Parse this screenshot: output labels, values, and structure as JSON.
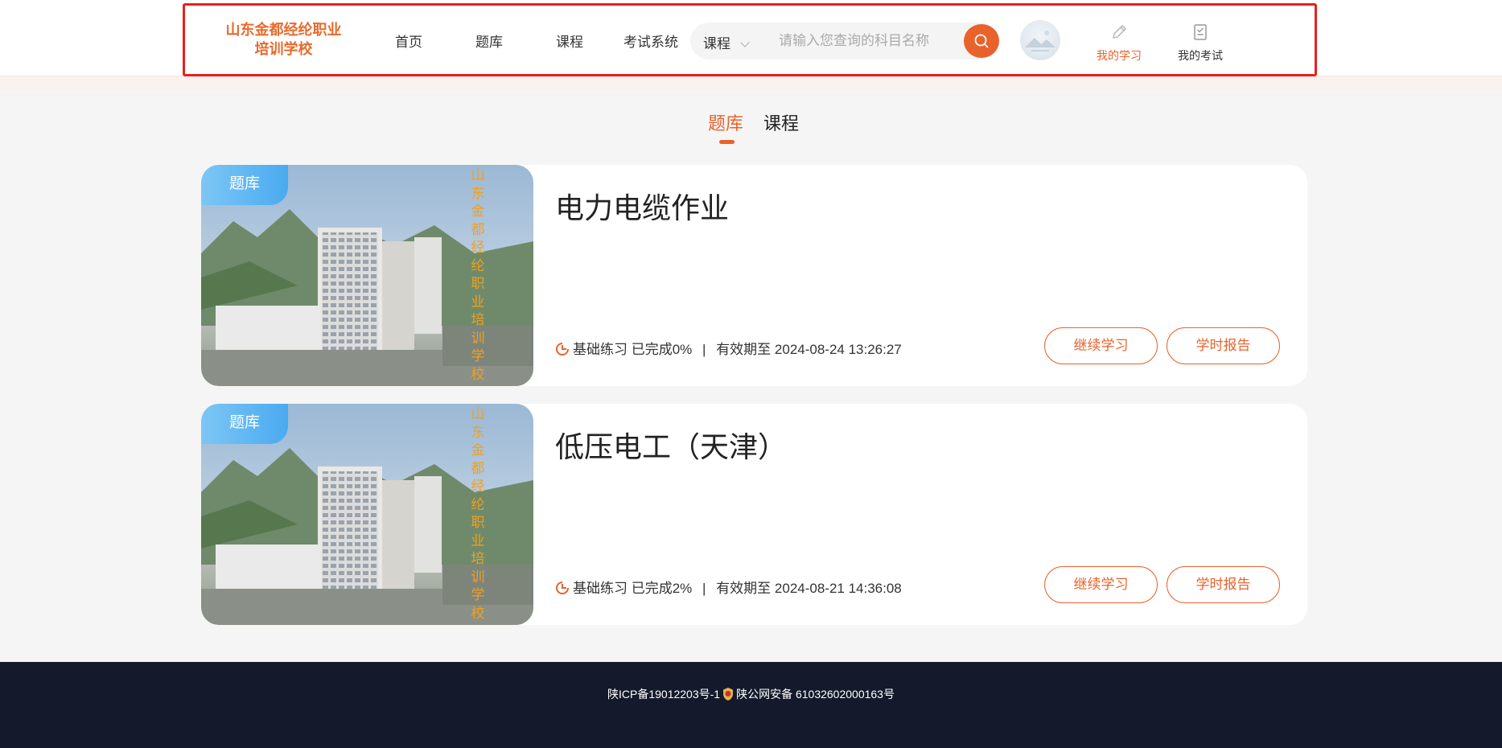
{
  "header": {
    "logo_line1": "山东金都经纶职业",
    "logo_line2": "培训学校",
    "nav": [
      {
        "label": "首页"
      },
      {
        "label": "题库"
      },
      {
        "label": "课程"
      },
      {
        "label": "考试系统"
      }
    ],
    "search": {
      "category": "课程",
      "placeholder": "请输入您查询的科目名称",
      "icon": "search-icon"
    },
    "avatar_icon": "avatar",
    "links": [
      {
        "label": "我的学习",
        "icon": "pencil-icon",
        "active": true
      },
      {
        "label": "我的考试",
        "icon": "exam-clipboard-icon",
        "active": false
      }
    ]
  },
  "tabs": [
    {
      "label": "题库",
      "active": true
    },
    {
      "label": "课程",
      "active": false
    }
  ],
  "cards": [
    {
      "badge": "题库",
      "vertical_text": "山东金都经纶职业培训学校",
      "title": "电力电缆作业",
      "progress_label": "基础练习 已完成0%",
      "separator": "|",
      "expiry": "有效期至 2024-08-24 13:26:27",
      "continue_label": "继续学习",
      "report_label": "学时报告"
    },
    {
      "badge": "题库",
      "vertical_text": "山东金都经纶职业培训学校",
      "title": "低压电工（天津）",
      "progress_label": "基础练习 已完成2%",
      "separator": "|",
      "expiry": "有效期至 2024-08-21 14:36:08",
      "continue_label": "继续学习",
      "report_label": "学时报告"
    }
  ],
  "footer": {
    "icp": "陕ICP备19012203号-1",
    "police": "陕公网安备 61032602000163号"
  },
  "colors": {
    "accent": "#e8632b",
    "footer_bg": "#141a2b",
    "badge": "#5db6f3",
    "highlight": "#e8201f"
  }
}
